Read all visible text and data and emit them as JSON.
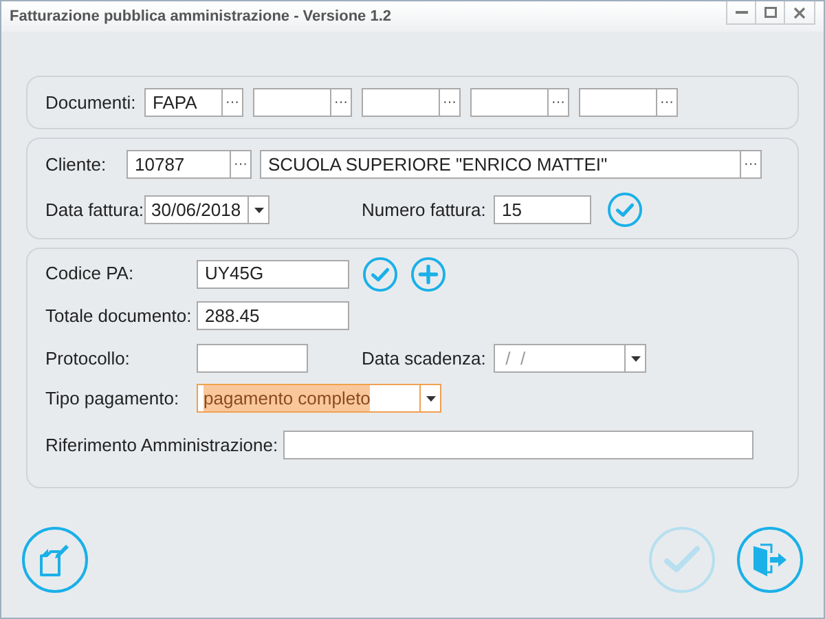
{
  "window": {
    "title": "Fatturazione pubblica amministrazione - Versione 1.2"
  },
  "documenti": {
    "label": "Documenti:",
    "fields": [
      {
        "value": "FAPA",
        "button": "···"
      },
      {
        "button": "···"
      },
      {
        "button": "···"
      },
      {
        "button": "···"
      },
      {
        "button": "···"
      }
    ]
  },
  "cliente": {
    "label": "Cliente:",
    "code": "10787",
    "code_button": "···",
    "name": "SCUOLA SUPERIORE \"ENRICO MATTEI\"",
    "name_button": "···"
  },
  "data_fattura": {
    "label": "Data fattura:",
    "value": "30/06/2018"
  },
  "numero_fattura": {
    "label": "Numero fattura:",
    "value": "15"
  },
  "codice_pa": {
    "label": "Codice PA:",
    "value": "UY45G"
  },
  "totale": {
    "label": "Totale documento:",
    "value": "288.45"
  },
  "protocollo": {
    "label": "Protocollo:"
  },
  "data_scadenza": {
    "label": "Data scadenza:",
    "placeholder": " /  /"
  },
  "tipo_pagamento": {
    "label": "Tipo pagamento:",
    "value": "pagamento completo",
    "focused": true,
    "text_selected": true
  },
  "riferimento": {
    "label": "Riferimento Amministrazione:"
  },
  "actions": [
    {
      "kind": "new",
      "disabled": false
    },
    {
      "kind": "confirm",
      "disabled": true
    },
    {
      "kind": "exit",
      "disabled": false
    }
  ]
}
